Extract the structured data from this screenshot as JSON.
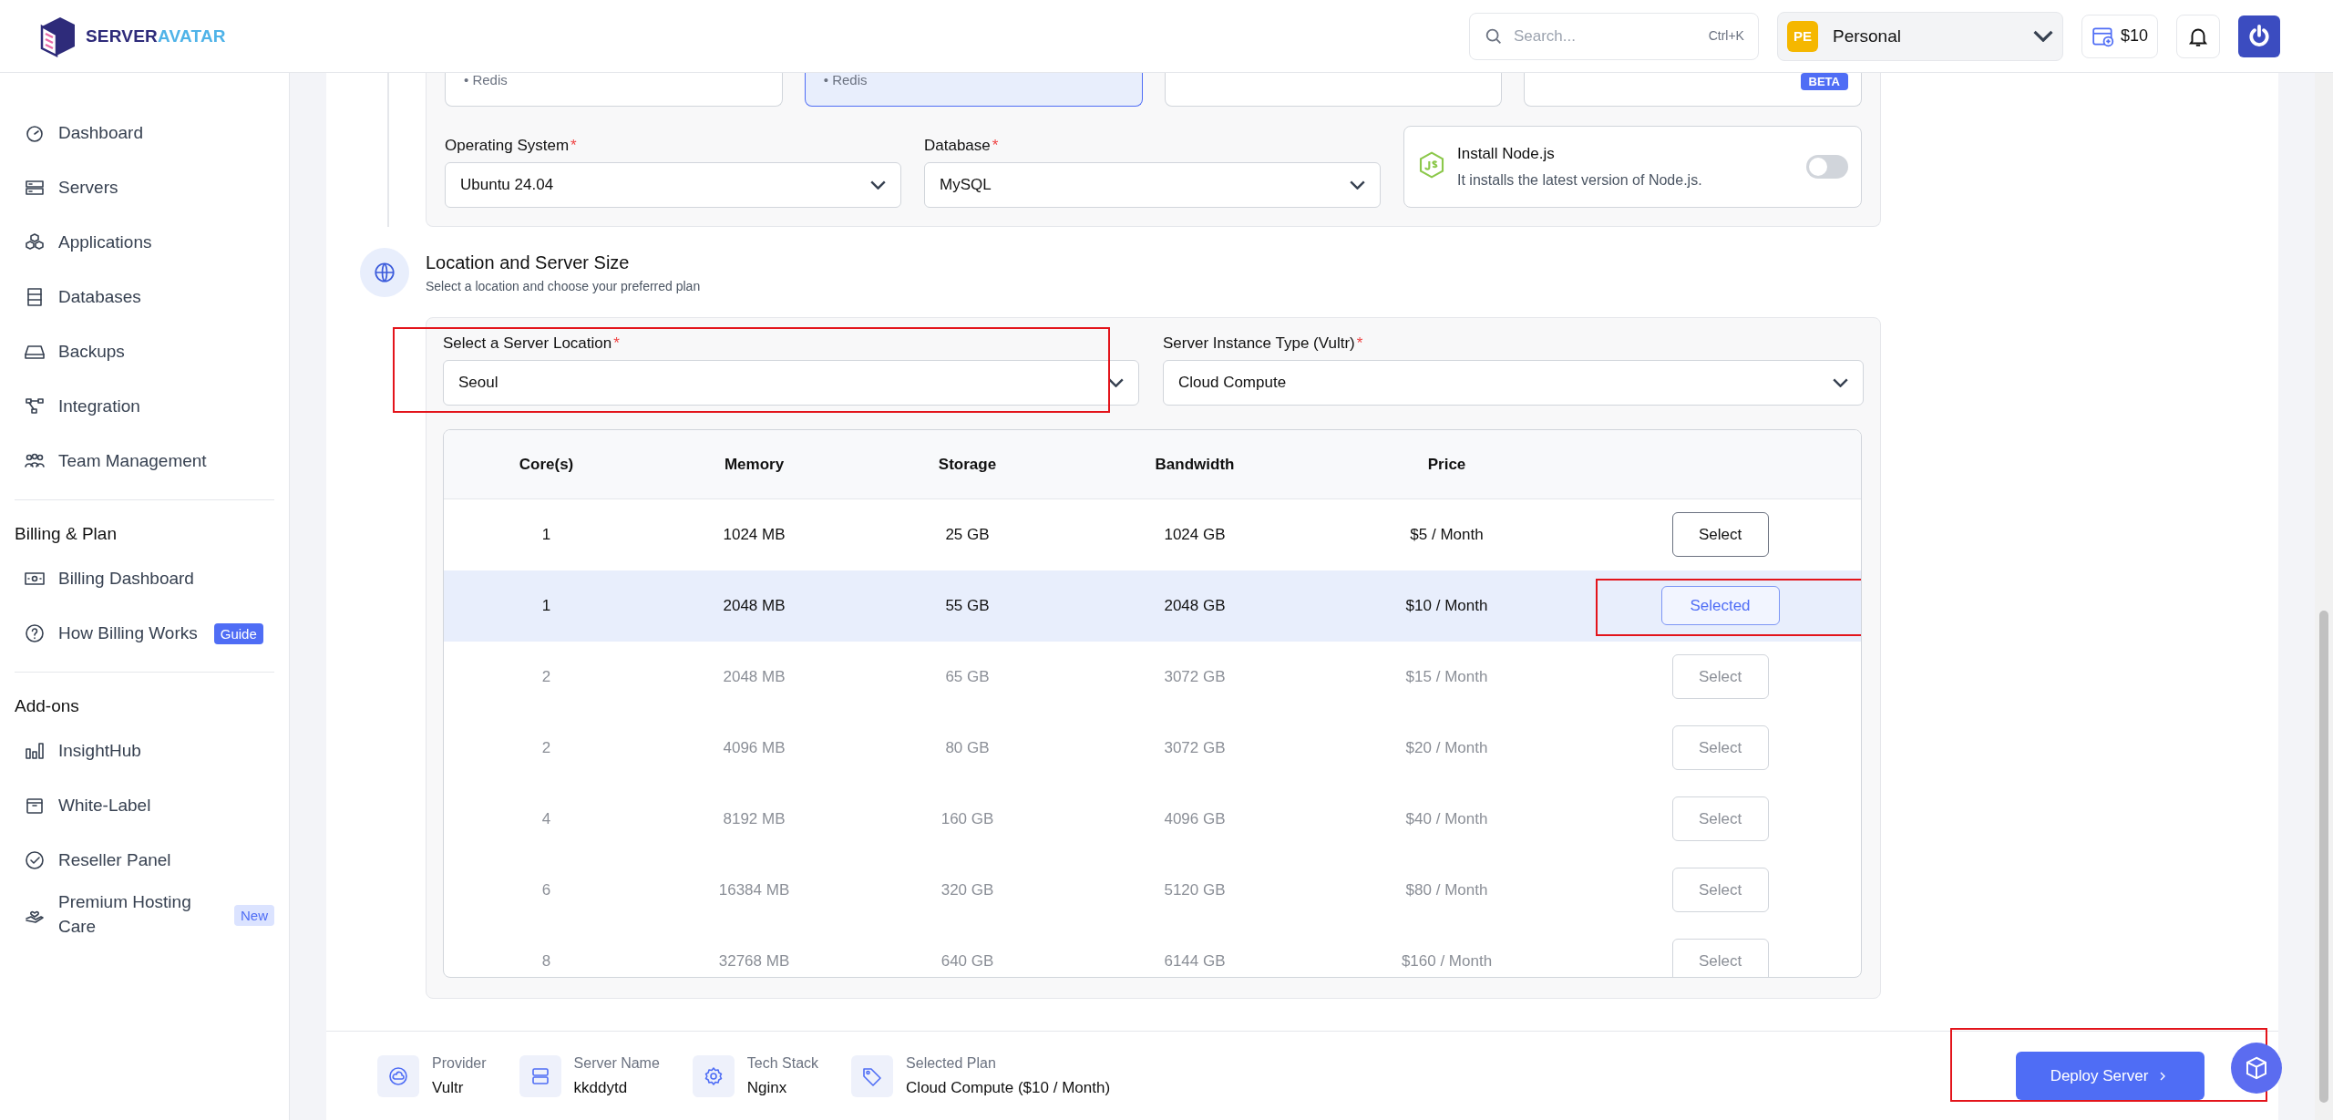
{
  "header": {
    "logo": {
      "primary": "SERVER",
      "secondary": "AVATAR"
    },
    "search": {
      "placeholder": "Search...",
      "shortcut": "Ctrl+K"
    },
    "workspace": {
      "initials": "PE",
      "name": "Personal"
    },
    "credit": "$10"
  },
  "sidebar": {
    "sections": [
      {
        "items": [
          {
            "label": "Dashboard"
          },
          {
            "label": "Servers"
          },
          {
            "label": "Applications"
          },
          {
            "label": "Databases"
          },
          {
            "label": "Backups"
          },
          {
            "label": "Integration"
          },
          {
            "label": "Team Management"
          }
        ]
      },
      {
        "heading": "Billing & Plan",
        "items": [
          {
            "label": "Billing Dashboard"
          },
          {
            "label": "How Billing Works",
            "badge": {
              "text": "Guide",
              "kind": "solid"
            }
          }
        ]
      },
      {
        "heading": "Add-ons",
        "items": [
          {
            "label": "InsightHub"
          },
          {
            "label": "White-Label"
          },
          {
            "label": "Reseller Panel"
          },
          {
            "label": "Premium Hosting Care",
            "badge": {
              "text": "New",
              "kind": "soft"
            }
          }
        ]
      }
    ]
  },
  "stack_cards": [
    {
      "marker": "•",
      "item": "Redis",
      "selected": false
    },
    {
      "marker": "•",
      "item": "Redis",
      "selected": true
    },
    {
      "selected": false
    },
    {
      "badge": "BETA",
      "selected": false
    }
  ],
  "operating_system": {
    "label": "Operating System",
    "required_mark": "*",
    "value": "Ubuntu 24.04"
  },
  "database": {
    "label": "Database",
    "required_mark": "*",
    "value": "MySQL"
  },
  "nodejs": {
    "title": "Install Node.js",
    "description": "It installs the latest version of Node.js.",
    "on": false
  },
  "location_section": {
    "title": "Location and Server Size",
    "subtitle": "Select a location and choose your preferred plan"
  },
  "server_location": {
    "label": "Select a Server Location",
    "required_mark": "*",
    "value": "Seoul",
    "highlighted": true
  },
  "instance_type": {
    "label": "Server Instance Type (Vultr)",
    "required_mark": "*",
    "value": "Cloud Compute"
  },
  "plans": {
    "columns": [
      "Core(s)",
      "Memory",
      "Storage",
      "Bandwidth",
      "Price"
    ],
    "rows": [
      {
        "cells": [
          "1",
          "1024 MB",
          "25 GB",
          "1024 GB",
          "$5 / Month"
        ],
        "button": "Select",
        "selected": false,
        "disabled": false
      },
      {
        "cells": [
          "1",
          "2048 MB",
          "55 GB",
          "2048 GB",
          "$10 / Month"
        ],
        "button": "Selected",
        "selected": true,
        "disabled": false,
        "highlighted": true
      },
      {
        "cells": [
          "2",
          "2048 MB",
          "65 GB",
          "3072 GB",
          "$15 / Month"
        ],
        "button": "Select",
        "selected": false,
        "disabled": true
      },
      {
        "cells": [
          "2",
          "4096 MB",
          "80 GB",
          "3072 GB",
          "$20 / Month"
        ],
        "button": "Select",
        "selected": false,
        "disabled": true
      },
      {
        "cells": [
          "4",
          "8192 MB",
          "160 GB",
          "4096 GB",
          "$40 / Month"
        ],
        "button": "Select",
        "selected": false,
        "disabled": true
      },
      {
        "cells": [
          "6",
          "16384 MB",
          "320 GB",
          "5120 GB",
          "$80 / Month"
        ],
        "button": "Select",
        "selected": false,
        "disabled": true
      },
      {
        "cells": [
          "8",
          "32768 MB",
          "640 GB",
          "6144 GB",
          "$160 / Month"
        ],
        "button": "Select",
        "selected": false,
        "disabled": true
      }
    ]
  },
  "summary": {
    "items": [
      {
        "label": "Provider",
        "value": "Vultr"
      },
      {
        "label": "Server Name",
        "value": "kkddytd"
      },
      {
        "label": "Tech Stack",
        "value": "Nginx"
      },
      {
        "label": "Selected Plan",
        "value": "Cloud Compute ($10 / Month)"
      }
    ],
    "deploy": {
      "label": "Deploy Server",
      "highlighted": true
    }
  }
}
